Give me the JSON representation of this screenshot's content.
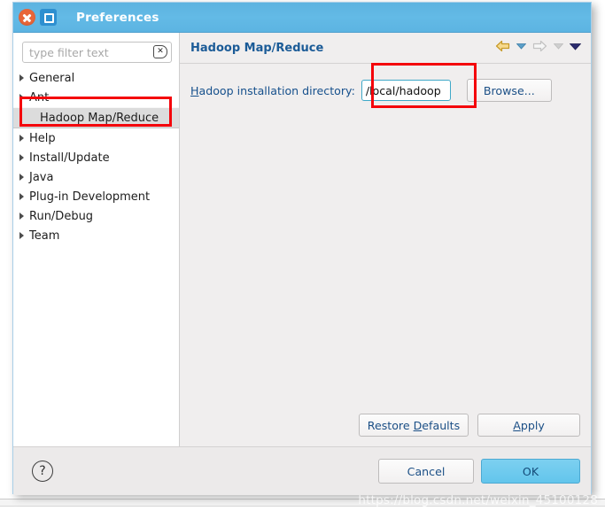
{
  "window": {
    "title": "Preferences",
    "close_icon": "close-icon",
    "maximize_icon": "maximize-icon",
    "titlebar_color": "#5cb4e2"
  },
  "sidebar": {
    "filter": {
      "placeholder": "type filter text",
      "value": "",
      "clear_icon": "clear-icon",
      "clear_glyph": "✕"
    },
    "items": [
      {
        "label": "General",
        "expandable": true,
        "selected": false
      },
      {
        "label": "Ant",
        "expandable": true,
        "selected": false
      },
      {
        "label": "Hadoop Map/Reduce",
        "expandable": false,
        "selected": true
      },
      {
        "label": "Help",
        "expandable": true,
        "selected": false
      },
      {
        "label": "Install/Update",
        "expandable": true,
        "selected": false
      },
      {
        "label": "Java",
        "expandable": true,
        "selected": false
      },
      {
        "label": "Plug-in Development",
        "expandable": true,
        "selected": false
      },
      {
        "label": "Run/Debug",
        "expandable": true,
        "selected": false
      },
      {
        "label": "Team",
        "expandable": true,
        "selected": false
      }
    ]
  },
  "page": {
    "title": "Hadoop Map/Reduce",
    "nav": {
      "back_icon": "back-arrow-icon",
      "back_menu_icon": "back-dropdown-icon",
      "forward_icon": "forward-arrow-icon",
      "forward_menu_icon": "forward-dropdown-icon",
      "view_menu_icon": "view-menu-dropdown-icon",
      "back_color": "#e8b93a",
      "forward_color": "#cfcfcf",
      "menu_color": "#2b2b6e"
    },
    "field": {
      "label_mnemonic": "H",
      "label_rest": "adoop installation directory:",
      "value": "/local/hadoop",
      "browse_label": "Browse...",
      "focus_border_color": "#3fa8c8"
    },
    "restore_defaults": {
      "mnemonic": "D",
      "before": "Restore ",
      "after": "efaults"
    },
    "apply": {
      "mnemonic": "A",
      "before": "",
      "after": "pply"
    }
  },
  "footer": {
    "help_icon": "help-icon",
    "help_glyph": "?",
    "cancel_label": "Cancel",
    "ok_label": "OK",
    "ok_color": "#63c5ec"
  },
  "annotations": {
    "tree_highlight_color": "#f4040b",
    "input_highlight_color": "#f4040b"
  },
  "watermark": {
    "text": "https://blog.csdn.net/weixin_45100128"
  }
}
